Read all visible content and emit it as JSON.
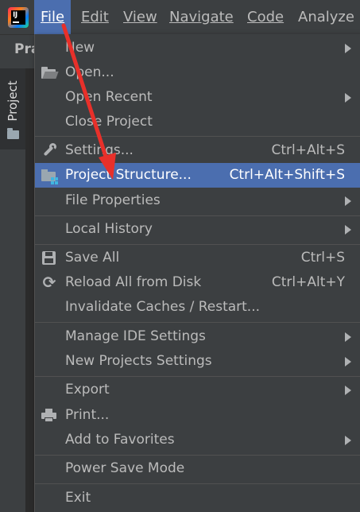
{
  "app_icon": "intellij-idea-icon",
  "menubar": {
    "items": [
      {
        "label": "File",
        "mnemonic_index": 0
      },
      {
        "label": "Edit",
        "mnemonic_index": 0
      },
      {
        "label": "View",
        "mnemonic_index": 0
      },
      {
        "label": "Navigate",
        "mnemonic_index": 0
      },
      {
        "label": "Code",
        "mnemonic_index": 0
      },
      {
        "label": "Analyze",
        "mnemonic_index": 1
      }
    ],
    "active": "File"
  },
  "toolbar": {
    "project_text": "Pra"
  },
  "tool_window": {
    "label": "Project",
    "icon": "folder-icon"
  },
  "file_menu": {
    "items": [
      {
        "label": "New",
        "icon": null,
        "shortcut": "",
        "submenu": true
      },
      {
        "label": "Open...",
        "icon": "folder-open-icon",
        "shortcut": "",
        "submenu": false
      },
      {
        "label": "Open Recent",
        "icon": null,
        "shortcut": "",
        "submenu": true
      },
      {
        "label": "Close Project",
        "icon": null,
        "shortcut": "",
        "submenu": false
      },
      {
        "label": "Settings...",
        "icon": "wrench-icon",
        "shortcut": "Ctrl+Alt+S",
        "submenu": false
      },
      {
        "label": "Project Structure...",
        "icon": "project-structure-icon",
        "shortcut": "Ctrl+Alt+Shift+S",
        "submenu": false,
        "selected": true
      },
      {
        "label": "File Properties",
        "icon": null,
        "shortcut": "",
        "submenu": true
      },
      {
        "label": "Local History",
        "icon": null,
        "shortcut": "",
        "submenu": true
      },
      {
        "label": "Save All",
        "icon": "save-icon",
        "shortcut": "Ctrl+S",
        "submenu": false
      },
      {
        "label": "Reload All from Disk",
        "icon": "reload-icon",
        "shortcut": "Ctrl+Alt+Y",
        "submenu": false
      },
      {
        "label": "Invalidate Caches / Restart...",
        "icon": null,
        "shortcut": "",
        "submenu": false
      },
      {
        "label": "Manage IDE Settings",
        "icon": null,
        "shortcut": "",
        "submenu": true
      },
      {
        "label": "New Projects Settings",
        "icon": null,
        "shortcut": "",
        "submenu": true
      },
      {
        "label": "Export",
        "icon": null,
        "shortcut": "",
        "submenu": true
      },
      {
        "label": "Print...",
        "icon": "print-icon",
        "shortcut": "",
        "submenu": false
      },
      {
        "label": "Add to Favorites",
        "icon": null,
        "shortcut": "",
        "submenu": true
      },
      {
        "label": "Power Save Mode",
        "icon": null,
        "shortcut": "",
        "submenu": false
      },
      {
        "label": "Exit",
        "icon": null,
        "shortcut": "",
        "submenu": false
      }
    ]
  },
  "annotation": {
    "type": "red-arrow",
    "color": "#e8302a"
  },
  "colors": {
    "background": "#3c3f41",
    "selection": "#4b6eaf",
    "text": "#bbbbbb",
    "separator": "#515151"
  }
}
